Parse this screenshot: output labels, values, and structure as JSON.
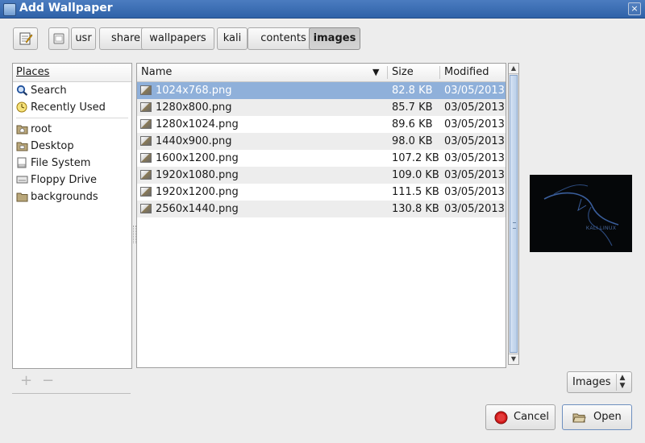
{
  "window": {
    "title": "Add Wallpaper",
    "close_glyph": "×"
  },
  "pathbar": {
    "edit_icon": "edit-location-icon",
    "back_icon": "path-root-icon",
    "segments": [
      "usr",
      "share",
      "wallpapers",
      "kali",
      "contents",
      "images"
    ],
    "active_segment": "images"
  },
  "places": {
    "header": "Places",
    "items": [
      {
        "label": "Search",
        "icon": "search-icon"
      },
      {
        "label": "Recently Used",
        "icon": "recent-icon"
      },
      {
        "label": "root",
        "icon": "home-folder-icon"
      },
      {
        "label": "Desktop",
        "icon": "desktop-folder-icon"
      },
      {
        "label": "File System",
        "icon": "file-system-icon"
      },
      {
        "label": "Floppy Drive",
        "icon": "floppy-drive-icon"
      },
      {
        "label": "backgrounds",
        "icon": "folder-icon"
      }
    ],
    "add_glyph": "+",
    "remove_glyph": "−"
  },
  "file_list": {
    "columns": {
      "name": "Name",
      "size": "Size",
      "modified": "Modified"
    },
    "sort_indicator": "▼",
    "rows": [
      {
        "name": "1024x768.png",
        "size": "82.8 KB",
        "modified": "03/05/2013",
        "selected": true
      },
      {
        "name": "1280x800.png",
        "size": "85.7 KB",
        "modified": "03/05/2013"
      },
      {
        "name": "1280x1024.png",
        "size": "89.6 KB",
        "modified": "03/05/2013"
      },
      {
        "name": "1440x900.png",
        "size": "98.0 KB",
        "modified": "03/05/2013"
      },
      {
        "name": "1600x1200.png",
        "size": "107.2 KB",
        "modified": "03/05/2013"
      },
      {
        "name": "1920x1080.png",
        "size": "109.0 KB",
        "modified": "03/05/2013"
      },
      {
        "name": "1920x1200.png",
        "size": "111.5 KB",
        "modified": "03/05/2013"
      },
      {
        "name": "2560x1440.png",
        "size": "130.8 KB",
        "modified": "03/05/2013"
      }
    ]
  },
  "preview": {
    "caption": "KALI LINUX",
    "colors": {
      "background": "#050709",
      "dragon": "#3a5e9c"
    }
  },
  "filter": {
    "selected": "Images"
  },
  "buttons": {
    "cancel": "Cancel",
    "open": "Open"
  },
  "colors": {
    "selection": "#8fb0da",
    "titlebar": "#3a6db5"
  }
}
